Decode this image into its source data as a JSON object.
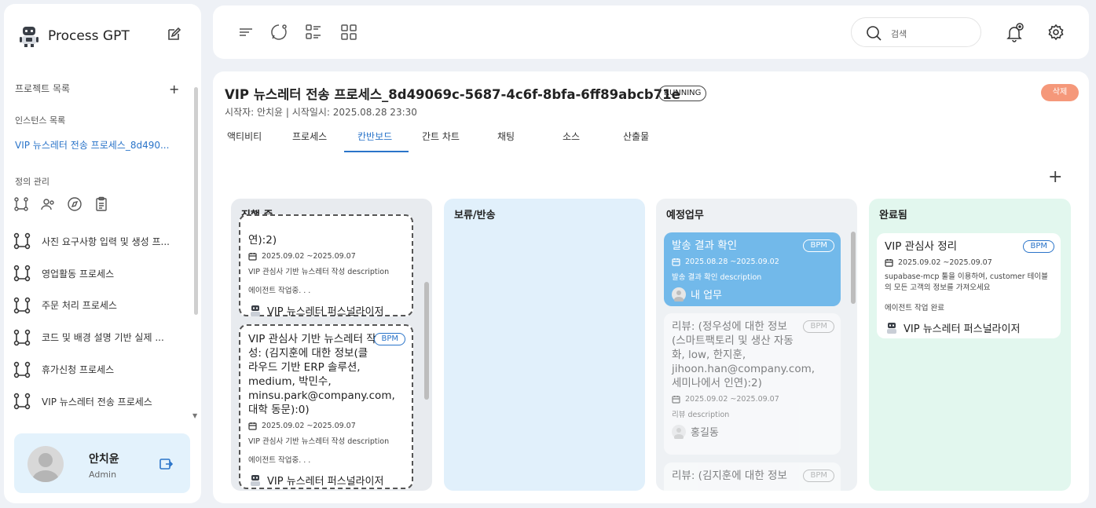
{
  "sidebar": {
    "app_name": "Process GPT",
    "project_list_label": "프로젝트 목록",
    "add_symbol": "+",
    "instance_list_label": "인스턴스 목록",
    "instance_item": "VIP 뉴스레터 전송 프로세스_8d490...",
    "definition_label": "정의 관리",
    "definition_icons": [
      "flow-icon",
      "users-icon",
      "compass-icon",
      "clipboard-icon"
    ],
    "processes": [
      "사진 요구사항 입력 및 생성 프...",
      "영업활동 프로세스",
      "주문 처리 프로세스",
      "코드 및 배경 설명 기반 실제 ...",
      "휴가신청 프로세스",
      "VIP 뉴스레터 전송 프로세스"
    ],
    "user": {
      "name": "안치윤",
      "role": "Admin"
    }
  },
  "topbar": {
    "search_placeholder": "검색",
    "icons": [
      "menu-icon",
      "chat-icon",
      "list-icon",
      "grid-icon"
    ]
  },
  "main": {
    "title": "VIP 뉴스레터 전송 프로세스_8d49069c-5687-4c6f-8bfa-6ff89abcb71e",
    "status_badge": "RUNNING",
    "subtitle": "시작자: 안치윤 | 시작일시: 2025.08.28 23:30",
    "delete_label": "삭제",
    "tabs": [
      "액티비티",
      "프로세스",
      "칸반보드",
      "간트 차트",
      "채팅",
      "소스",
      "산출물"
    ],
    "active_tab": "칸반보드",
    "add_symbol": "+"
  },
  "kanban": {
    "columns": [
      {
        "title": "진행 중",
        "color": "#e8ebef",
        "cards": [
          {
            "title_tail": "연):2)",
            "date": "2025.09.02 ~2025.09.07",
            "desc": "VIP 관심사 기반 뉴스레터 작성 description",
            "status": "에이전트 작업중. . .",
            "assignee": "VIP 뉴스레터 퍼스널라이저"
          },
          {
            "title": "VIP 관심사 기반 뉴스레터 작성: (김지훈에 대한 정보(클라우드 기반 ERP 솔루션, medium, 박민수, minsu.park@company.com, 대학 동문):0)",
            "badge": "BPM",
            "date": "2025.09.02 ~2025.09.07",
            "desc": "VIP 관심사 기반 뉴스레터 작성 description",
            "status": "에이전트 작업중. . .",
            "assignee": "VIP 뉴스레터 퍼스널라이저"
          }
        ]
      },
      {
        "title": "보류/반송",
        "color": "#e1f0fb",
        "cards": []
      },
      {
        "title": "예정업무",
        "color": "#eef1f4",
        "cards": [
          {
            "title": "발송 결과 확인",
            "badge": "BPM",
            "date": "2025.08.28 ~2025.09.02",
            "desc": "발송 결과 확인 description",
            "assignee": "내 업무"
          },
          {
            "title": "리뷰: (정우성에 대한 정보(스마트팩토리 및 생산 자동화, low, 한지훈, jihoon.han@company.com, 세미나에서 인연):2)",
            "badge": "BPM",
            "date": "2025.09.02 ~2025.09.07",
            "desc": "리뷰 description",
            "assignee": "홍길동"
          },
          {
            "title": "리뷰: (김지훈에 대한 정보",
            "badge": "BPM"
          }
        ]
      },
      {
        "title": "완료됨",
        "color": "#e2f7ee",
        "cards": [
          {
            "title": "VIP 관심사 정리",
            "badge": "BPM",
            "date": "2025.09.02 ~2025.09.07",
            "desc": "supabase-mcp 툴을 이용하여, customer 테이블의 모든 고객의 정보를 가져오세요",
            "status": "에이전트 작업 완료",
            "assignee": "VIP 뉴스레터 퍼스널라이저"
          }
        ]
      }
    ]
  },
  "colors": {
    "accent": "#2a74c9",
    "delete": "#f5987a",
    "scheduled_card": "#72b9ea"
  }
}
